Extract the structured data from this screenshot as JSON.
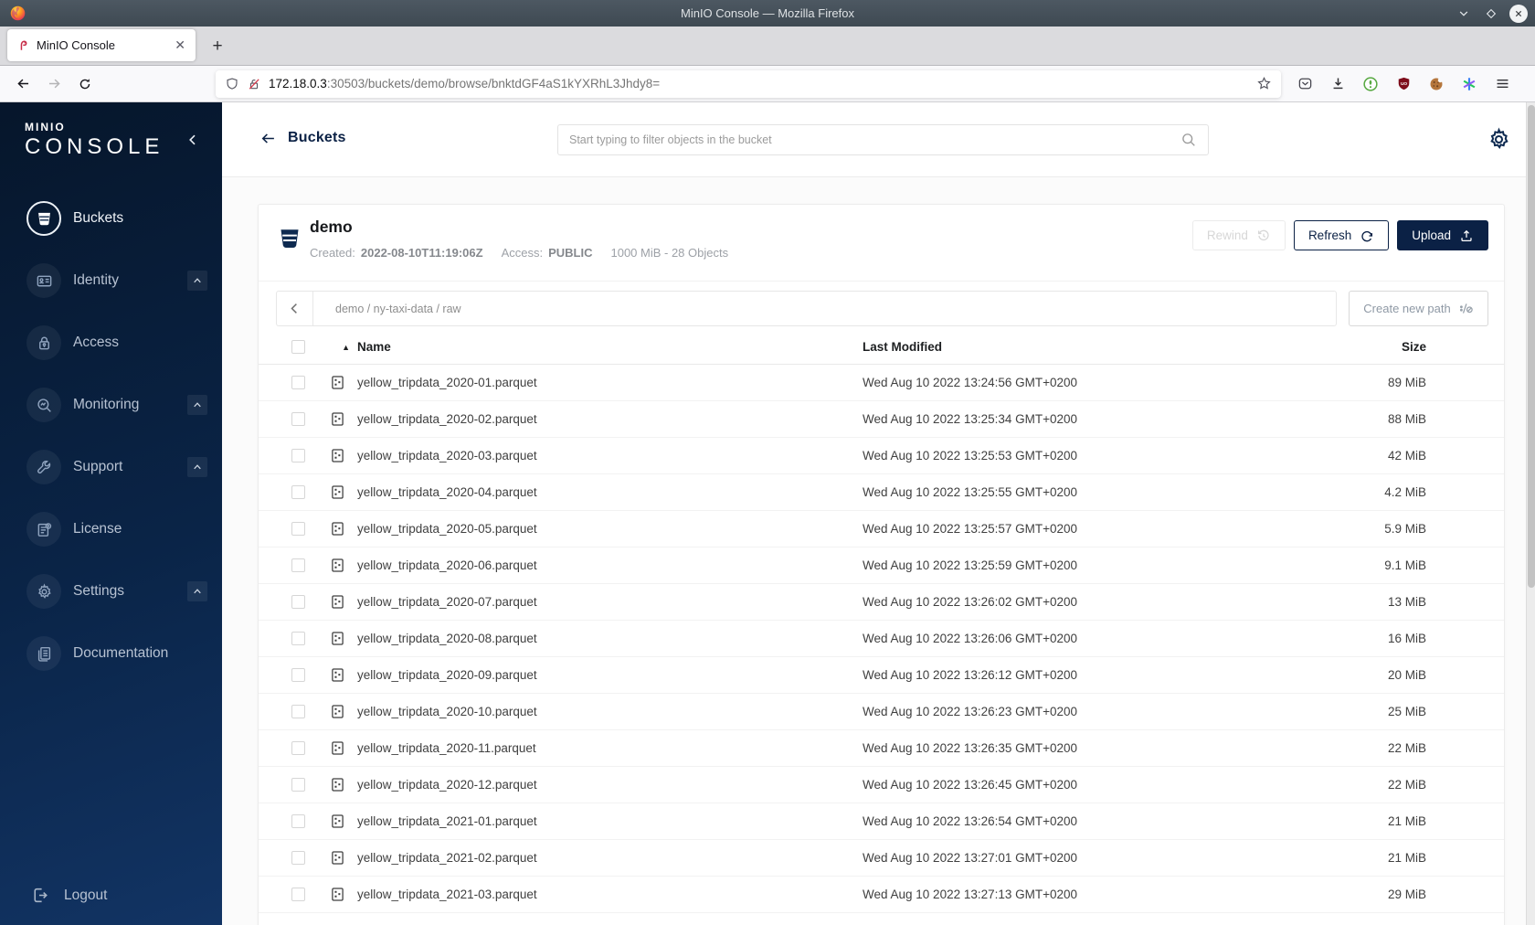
{
  "window": {
    "title": "MinIO Console — Mozilla Firefox"
  },
  "browser": {
    "tab_title": "MinIO Console",
    "url_host": "172.18.0.3",
    "url_rest": ":30503/buckets/demo/browse/bnktdGF4aS1kYXRhL3Jhdy8="
  },
  "sidebar": {
    "logo_top": "MINIO",
    "logo_bottom": "CONSOLE",
    "items": [
      {
        "label": "Buckets",
        "icon": "bucket",
        "active": true,
        "expandable": false
      },
      {
        "label": "Identity",
        "icon": "identity",
        "active": false,
        "expandable": true
      },
      {
        "label": "Access",
        "icon": "access",
        "active": false,
        "expandable": false
      },
      {
        "label": "Monitoring",
        "icon": "monitoring",
        "active": false,
        "expandable": true
      },
      {
        "label": "Support",
        "icon": "support",
        "active": false,
        "expandable": true
      },
      {
        "label": "License",
        "icon": "license",
        "active": false,
        "expandable": false
      },
      {
        "label": "Settings",
        "icon": "settings",
        "active": false,
        "expandable": true
      },
      {
        "label": "Documentation",
        "icon": "documentation",
        "active": false,
        "expandable": false
      }
    ],
    "logout_label": "Logout"
  },
  "header": {
    "back_label": "Buckets",
    "search_placeholder": "Start typing to filter objects in the bucket"
  },
  "bucket": {
    "name": "demo",
    "created_label": "Created:",
    "created_value": "2022-08-10T11:19:06Z",
    "access_label": "Access:",
    "access_value": "PUBLIC",
    "usage": "1000 MiB - 28 Objects",
    "rewind_label": "Rewind",
    "refresh_label": "Refresh",
    "upload_label": "Upload"
  },
  "browse": {
    "path": "demo / ny-taxi-data / raw",
    "create_path_label": "Create new path",
    "columns": {
      "name": "Name",
      "modified": "Last Modified",
      "size": "Size"
    },
    "rows": [
      {
        "name": "yellow_tripdata_2020-01.parquet",
        "modified": "Wed Aug 10 2022 13:24:56 GMT+0200",
        "size": "89 MiB"
      },
      {
        "name": "yellow_tripdata_2020-02.parquet",
        "modified": "Wed Aug 10 2022 13:25:34 GMT+0200",
        "size": "88 MiB"
      },
      {
        "name": "yellow_tripdata_2020-03.parquet",
        "modified": "Wed Aug 10 2022 13:25:53 GMT+0200",
        "size": "42 MiB"
      },
      {
        "name": "yellow_tripdata_2020-04.parquet",
        "modified": "Wed Aug 10 2022 13:25:55 GMT+0200",
        "size": "4.2 MiB"
      },
      {
        "name": "yellow_tripdata_2020-05.parquet",
        "modified": "Wed Aug 10 2022 13:25:57 GMT+0200",
        "size": "5.9 MiB"
      },
      {
        "name": "yellow_tripdata_2020-06.parquet",
        "modified": "Wed Aug 10 2022 13:25:59 GMT+0200",
        "size": "9.1 MiB"
      },
      {
        "name": "yellow_tripdata_2020-07.parquet",
        "modified": "Wed Aug 10 2022 13:26:02 GMT+0200",
        "size": "13 MiB"
      },
      {
        "name": "yellow_tripdata_2020-08.parquet",
        "modified": "Wed Aug 10 2022 13:26:06 GMT+0200",
        "size": "16 MiB"
      },
      {
        "name": "yellow_tripdata_2020-09.parquet",
        "modified": "Wed Aug 10 2022 13:26:12 GMT+0200",
        "size": "20 MiB"
      },
      {
        "name": "yellow_tripdata_2020-10.parquet",
        "modified": "Wed Aug 10 2022 13:26:23 GMT+0200",
        "size": "25 MiB"
      },
      {
        "name": "yellow_tripdata_2020-11.parquet",
        "modified": "Wed Aug 10 2022 13:26:35 GMT+0200",
        "size": "22 MiB"
      },
      {
        "name": "yellow_tripdata_2020-12.parquet",
        "modified": "Wed Aug 10 2022 13:26:45 GMT+0200",
        "size": "22 MiB"
      },
      {
        "name": "yellow_tripdata_2021-01.parquet",
        "modified": "Wed Aug 10 2022 13:26:54 GMT+0200",
        "size": "21 MiB"
      },
      {
        "name": "yellow_tripdata_2021-02.parquet",
        "modified": "Wed Aug 10 2022 13:27:01 GMT+0200",
        "size": "21 MiB"
      },
      {
        "name": "yellow_tripdata_2021-03.parquet",
        "modified": "Wed Aug 10 2022 13:27:13 GMT+0200",
        "size": "29 MiB"
      }
    ]
  },
  "colors": {
    "navy": "#081C42",
    "minio_red": "#C72C48"
  }
}
